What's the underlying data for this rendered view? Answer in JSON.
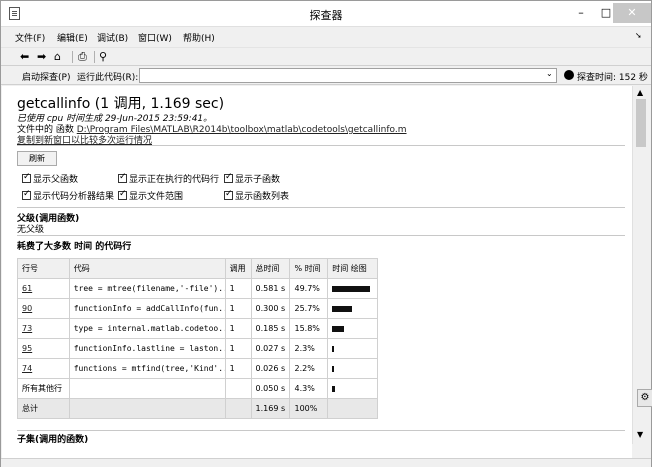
{
  "window": {
    "title": "探查器"
  },
  "menu": [
    "文件(F)",
    "编辑(E)",
    "调试(B)",
    "窗口(W)",
    "帮助(H)"
  ],
  "toolbar": {
    "icons": [
      "back-arrow-icon",
      "forward-arrow-icon",
      "home-icon",
      "print-icon",
      "find-icon"
    ]
  },
  "runbar": {
    "start_label": "启动探查(P)",
    "run_label": "运行此代码(R):",
    "run_value": "",
    "time_label": "探查时间: 152 秒"
  },
  "report": {
    "title": "getcallinfo (1 调用, 1.169 sec)",
    "generated_prefix": "已使用 cpu 时间生成 ",
    "generated_value": "29-Jun-2015 23:59:41。",
    "file_prefix": "文件中的 函数 ",
    "file_path": "D:\\Program Files\\MATLAB\\R2014b\\toolbox\\matlab\\codetools\\getcallinfo.m",
    "copy_link": "复制到新窗口以比较多次运行情况",
    "refresh_label": "刷新",
    "options": [
      {
        "label": "显示父函数",
        "checked": true
      },
      {
        "label": "显示正在执行的代码行",
        "checked": true
      },
      {
        "label": "显示子函数",
        "checked": true
      },
      {
        "label": "显示代码分析器结果",
        "checked": true
      },
      {
        "label": "显示文件范围",
        "checked": true
      },
      {
        "label": "显示函数列表",
        "checked": true
      }
    ],
    "parents_heading": "父级(调用函数)",
    "parents_value": "无父级",
    "lines_heading": "耗费了大多数 时间 的代码行",
    "table": {
      "headers": [
        "行号",
        "代码",
        "调用",
        "总时间",
        "% 时间",
        "时间 绘图"
      ],
      "rows": [
        {
          "line": "61",
          "code": "tree = mtree(filename,'-file')...",
          "calls": "1",
          "total": "0.581 s",
          "pct": "49.7%",
          "frac": 0.497
        },
        {
          "line": "90",
          "code": "functionInfo = addCallInfo(fun...",
          "calls": "1",
          "total": "0.300 s",
          "pct": "25.7%",
          "frac": 0.257
        },
        {
          "line": "73",
          "code": "type = internal.matlab.codetoo...",
          "calls": "1",
          "total": "0.185 s",
          "pct": "15.8%",
          "frac": 0.158
        },
        {
          "line": "95",
          "code": "functionInfo.lastline = laston...",
          "calls": "1",
          "total": "0.027 s",
          "pct": "2.3%",
          "frac": 0.023
        },
        {
          "line": "74",
          "code": "functions = mtfind(tree,'Kind'...",
          "calls": "1",
          "total": "0.026 s",
          "pct": "2.2%",
          "frac": 0.022
        }
      ],
      "other": {
        "label": "所有其他行",
        "total": "0.050 s",
        "pct": "4.3%",
        "frac": 0.043
      },
      "sum": {
        "label": "总计",
        "total": "1.169 s",
        "pct": "100%"
      }
    },
    "children_heading": "子集(调用的函数)"
  }
}
